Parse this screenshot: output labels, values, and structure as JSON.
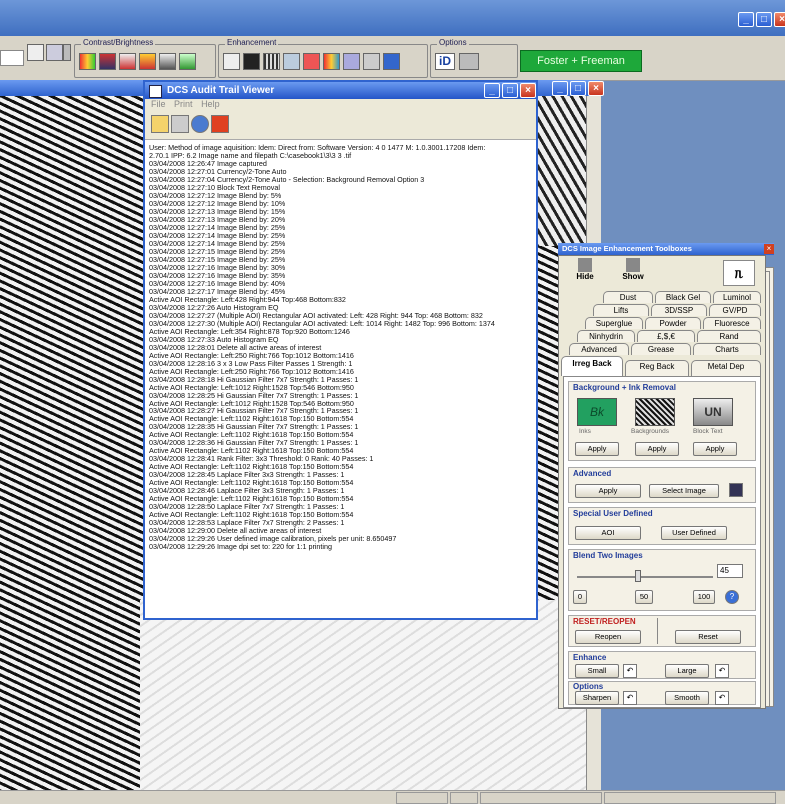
{
  "colors": {
    "title_blue": "#2f63cf",
    "status_green": "#1ea83a",
    "ink_green": "#22a060"
  },
  "toolbar": {
    "group_contrast": "Contrast/Brightness",
    "group_enhancement": "Enhancement",
    "group_options": "Options",
    "status": "Foster + Freeman"
  },
  "audit": {
    "title": "DCS Audit Trail Viewer",
    "menu": [
      "File",
      "Print",
      "Help"
    ],
    "lines": [
      "User:  Method of image aquisition: Idem: Direct from:   Software Version: 4 0 1477  M: 1.0.3001.17208  Idem:",
      "2.70.1 IPP: 6.2  Image name and filepath  C:\\casebook1\\3\\3 3  .tif",
      "03/04/2008  12:26:47  Image captured",
      "03/04/2008  12:27:01  Currency/2-Tone Auto",
      "03/04/2008  12:27:04  Currency/2-Tone Auto - Selection: Background Removal Option 3",
      "03/04/2008  12:27:10  Block Text Removal",
      "03/04/2008  12:27:12  Image Blend by:  5%",
      "03/04/2008  12:27:12  Image Blend by:  10%",
      "03/04/2008  12:27:13  Image Blend by:  15%",
      "03/04/2008  12:27:13  Image Blend by:  20%",
      "03/04/2008  12:27:14  Image Blend by:  25%",
      "03/04/2008  12:27:14  Image Blend by:  25%",
      "03/04/2008  12:27:14  Image Blend by:  25%",
      "03/04/2008  12:27:15  Image Blend by:  25%",
      "03/04/2008  12:27:15  Image Blend by:  25%",
      "03/04/2008  12:27:16  Image Blend by:  30%",
      "03/04/2008  12:27:16  Image Blend by:  35%",
      "03/04/2008  12:27:16  Image Blend by:  40%",
      "03/04/2008  12:27:17  Image Blend by:  45%",
      "Active AOI Rectangle: Left:428 Right:944 Top:468 Bottom:832",
      "03/04/2008  12:27:26  Auto Histogram EQ",
      "03/04/2008  12:27:27  (Multiple AOI) Rectangular AOI activated:  Left: 428 Right: 944 Top: 468 Bottom: 832",
      "03/04/2008  12:27:30  (Multiple AOI) Rectangular AOI activated:  Left: 1014 Right: 1482 Top: 996 Bottom: 1374",
      "Active AOI Rectangle: Left:354 Right:878 Top:920 Bottom:1246",
      "03/04/2008  12:27:33  Auto Histogram EQ",
      "03/04/2008  12:28:01  Delete all active areas of interest",
      "Active AOI Rectangle: Left:250 Right:766 Top:1012 Bottom:1416",
      "03/04/2008  12:28:16  3 x 3 Low Pass Filter Passes 1 Strength: 1",
      "Active AOI Rectangle: Left:250 Right:766 Top:1012 Bottom:1416",
      "03/04/2008  12:28:18  Hi Gaussian Filter 7x7 Strength: 1 Passes:  1",
      "Active AOI Rectangle: Left:1012 Right:1528 Top:546 Bottom:950",
      "03/04/2008  12:28:25  Hi Gaussian Filter 7x7 Strength: 1 Passes:  1",
      "Active AOI Rectangle: Left:1012 Right:1528 Top:546 Bottom:950",
      "03/04/2008  12:28:27  Hi Gaussian Filter 7x7 Strength: 1 Passes:  1",
      "Active AOI Rectangle: Left:1102 Right:1618 Top:150 Bottom:554",
      "03/04/2008  12:28:35  Hi Gaussian Filter 7x7 Strength: 1 Passes:  1",
      "Active AOI Rectangle: Left:1102 Right:1618 Top:150 Bottom:554",
      "03/04/2008  12:28:36  Hi Gaussian Filter 7x7 Strength: 1 Passes:  1",
      "Active AOI Rectangle: Left:1102 Right:1618 Top:150 Bottom:554",
      "03/04/2008  12:28:41  Rank Filter: 3x3 Threshold: 0 Rank: 40 Passes: 1",
      "Active AOI Rectangle: Left:1102 Right:1618 Top:150 Bottom:554",
      "03/04/2008  12:28:45  Laplace Filter 3x3 Strength: 1 Passes: 1",
      "Active AOI Rectangle: Left:1102 Right:1618 Top:150 Bottom:554",
      "03/04/2008  12:28:46  Laplace Filter 3x3 Strength: 1 Passes: 1",
      "Active AOI Rectangle: Left:1102 Right:1618 Top:150 Bottom:554",
      "03/04/2008  12:28:50  Laplace Filter 7x7 Strength: 1 Passes: 1",
      "Active AOI Rectangle: Left:1102 Right:1618 Top:150 Bottom:554",
      "03/04/2008  12:28:53  Laplace Filter 7x7 Strength: 2 Passes: 1",
      "03/04/2008  12:29:00  Delete all active areas of interest",
      "03/04/2008  12:29:26  User defined image calibration, pixels per unit: 8.650497",
      "03/04/2008  12:29:26  Image dpi set to: 220  for 1:1 printing"
    ]
  },
  "toolbox": {
    "title": "DCS Image Enhancement Toolboxes",
    "hide": "Hide",
    "show": "Show",
    "tabs_row1": [
      "Dust",
      "Black Gel",
      "Luminol"
    ],
    "tabs_row2": [
      "Lifts",
      "3D/SSP",
      "GV/PD"
    ],
    "tabs_row3": [
      "Superglue",
      "Powder",
      "Fluoresce"
    ],
    "tabs_row4": [
      "Ninhydrin",
      "£,$,€",
      "Rand"
    ],
    "tabs_row5": [
      "Advanced",
      "Grease",
      "Charts"
    ],
    "tabs_row6": [
      "Irreg Back",
      "Reg Back",
      "Metal Dep"
    ],
    "bg_section": "Background + Ink Removal",
    "swatch_ink_text": "Bk",
    "swatch_logo_text": "UN",
    "sub_inks": "Inks",
    "sub_backgrounds": "Backgrounds",
    "sub_blocktext": "Block Text",
    "apply": "Apply",
    "advanced": "Advanced",
    "select_image": "Select Image",
    "special": "Special User Defined",
    "aoi": "AOI",
    "user_defined": "User Defined",
    "blend": "Blend Two Images",
    "blend_value": "45",
    "blend_level": 0.45,
    "blend_min": "0",
    "blend_mid": "50",
    "blend_max": "100",
    "reset_section": "RESET/REOPEN",
    "reopen": "Reopen",
    "reset": "Reset",
    "enhance": "Enhance",
    "small": "Small",
    "large": "Large",
    "options": "Options",
    "sharpen": "Sharpen",
    "smooth": "Smooth"
  }
}
